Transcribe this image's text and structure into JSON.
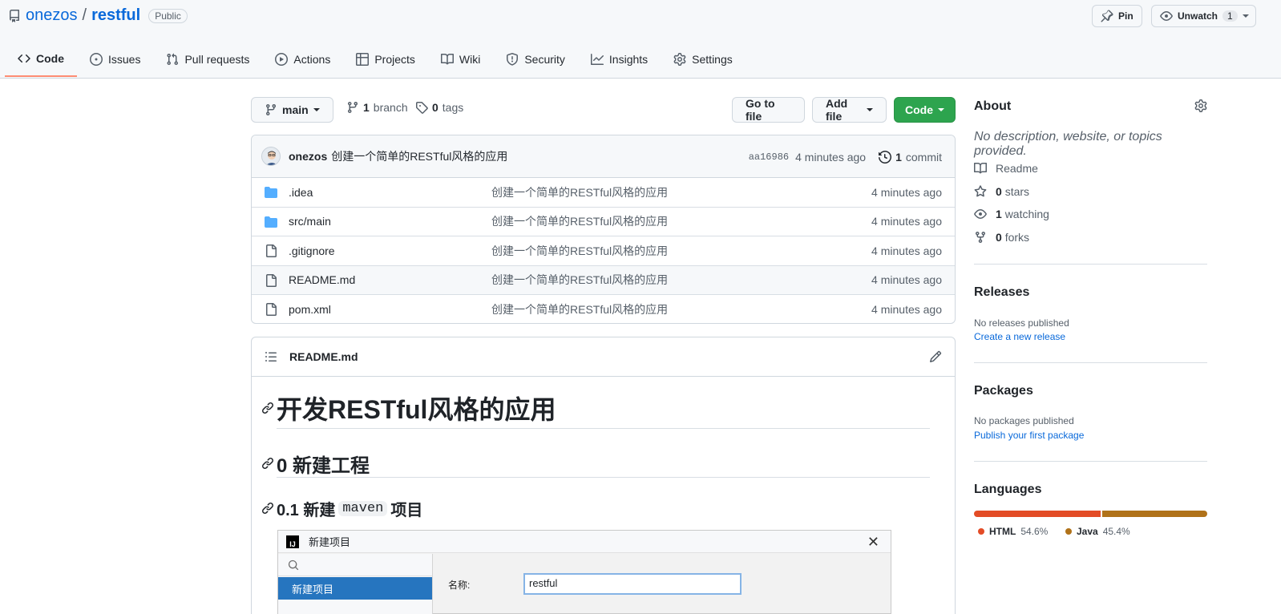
{
  "repo": {
    "owner": "onezos",
    "separator": "/",
    "name": "restful",
    "visibility": "Public"
  },
  "header_actions": {
    "pin_label": "Pin",
    "unwatch_label": "Unwatch",
    "watch_count": "1"
  },
  "tabs": [
    {
      "label": "Code",
      "icon": "code-icon"
    },
    {
      "label": "Issues",
      "icon": "issue-icon"
    },
    {
      "label": "Pull requests",
      "icon": "pull-request-icon"
    },
    {
      "label": "Actions",
      "icon": "play-icon"
    },
    {
      "label": "Projects",
      "icon": "table-icon"
    },
    {
      "label": "Wiki",
      "icon": "book-icon"
    },
    {
      "label": "Security",
      "icon": "shield-icon"
    },
    {
      "label": "Insights",
      "icon": "graph-icon"
    },
    {
      "label": "Settings",
      "icon": "gear-icon"
    }
  ],
  "toolbar": {
    "branch": "main",
    "branch_count": "1",
    "branch_label": "branch",
    "tag_count": "0",
    "tag_label": "tags",
    "go_to_file": "Go to file",
    "add_file": "Add file",
    "code": "Code"
  },
  "commit": {
    "author": "onezos",
    "message": "创建一个简单的RESTful风格的应用",
    "sha": "aa16986",
    "age": "4 minutes ago",
    "count": "1",
    "count_label": "commit"
  },
  "files": [
    {
      "type": "dir",
      "name": ".idea",
      "message": "创建一个简单的RESTful风格的应用",
      "age": "4 minutes ago"
    },
    {
      "type": "dir",
      "name": "src/main",
      "message": "创建一个简单的RESTful风格的应用",
      "age": "4 minutes ago"
    },
    {
      "type": "file",
      "name": ".gitignore",
      "message": "创建一个简单的RESTful风格的应用",
      "age": "4 minutes ago"
    },
    {
      "type": "file",
      "name": "README.md",
      "message": "创建一个简单的RESTful风格的应用",
      "age": "4 minutes ago"
    },
    {
      "type": "file",
      "name": "pom.xml",
      "message": "创建一个简单的RESTful风格的应用",
      "age": "4 minutes ago"
    }
  ],
  "readme": {
    "filename": "README.md",
    "h1": "开发RESTful风格的应用",
    "h2": "0 新建工程",
    "h3_prefix": "0.1 新建",
    "h3_code": "maven",
    "h3_suffix": "项目",
    "ide": {
      "title": "新建项目",
      "selected_item": "新建项目",
      "name_label": "名称:",
      "name_value": "restful"
    }
  },
  "about": {
    "title": "About",
    "description": "No description, website, or topics provided.",
    "readme_label": "Readme",
    "stars_count": "0",
    "stars_label": "stars",
    "watching_count": "1",
    "watching_label": "watching",
    "forks_count": "0",
    "forks_label": "forks"
  },
  "releases": {
    "title": "Releases",
    "status": "No releases published",
    "link": "Create a new release"
  },
  "packages": {
    "title": "Packages",
    "status": "No packages published",
    "link": "Publish your first package"
  },
  "languages": {
    "title": "Languages",
    "items": [
      {
        "name": "HTML",
        "percent": "54.6%",
        "value": 54.6,
        "color": "#e34c26"
      },
      {
        "name": "Java",
        "percent": "45.4%",
        "value": 45.4,
        "color": "#b07219"
      }
    ]
  }
}
